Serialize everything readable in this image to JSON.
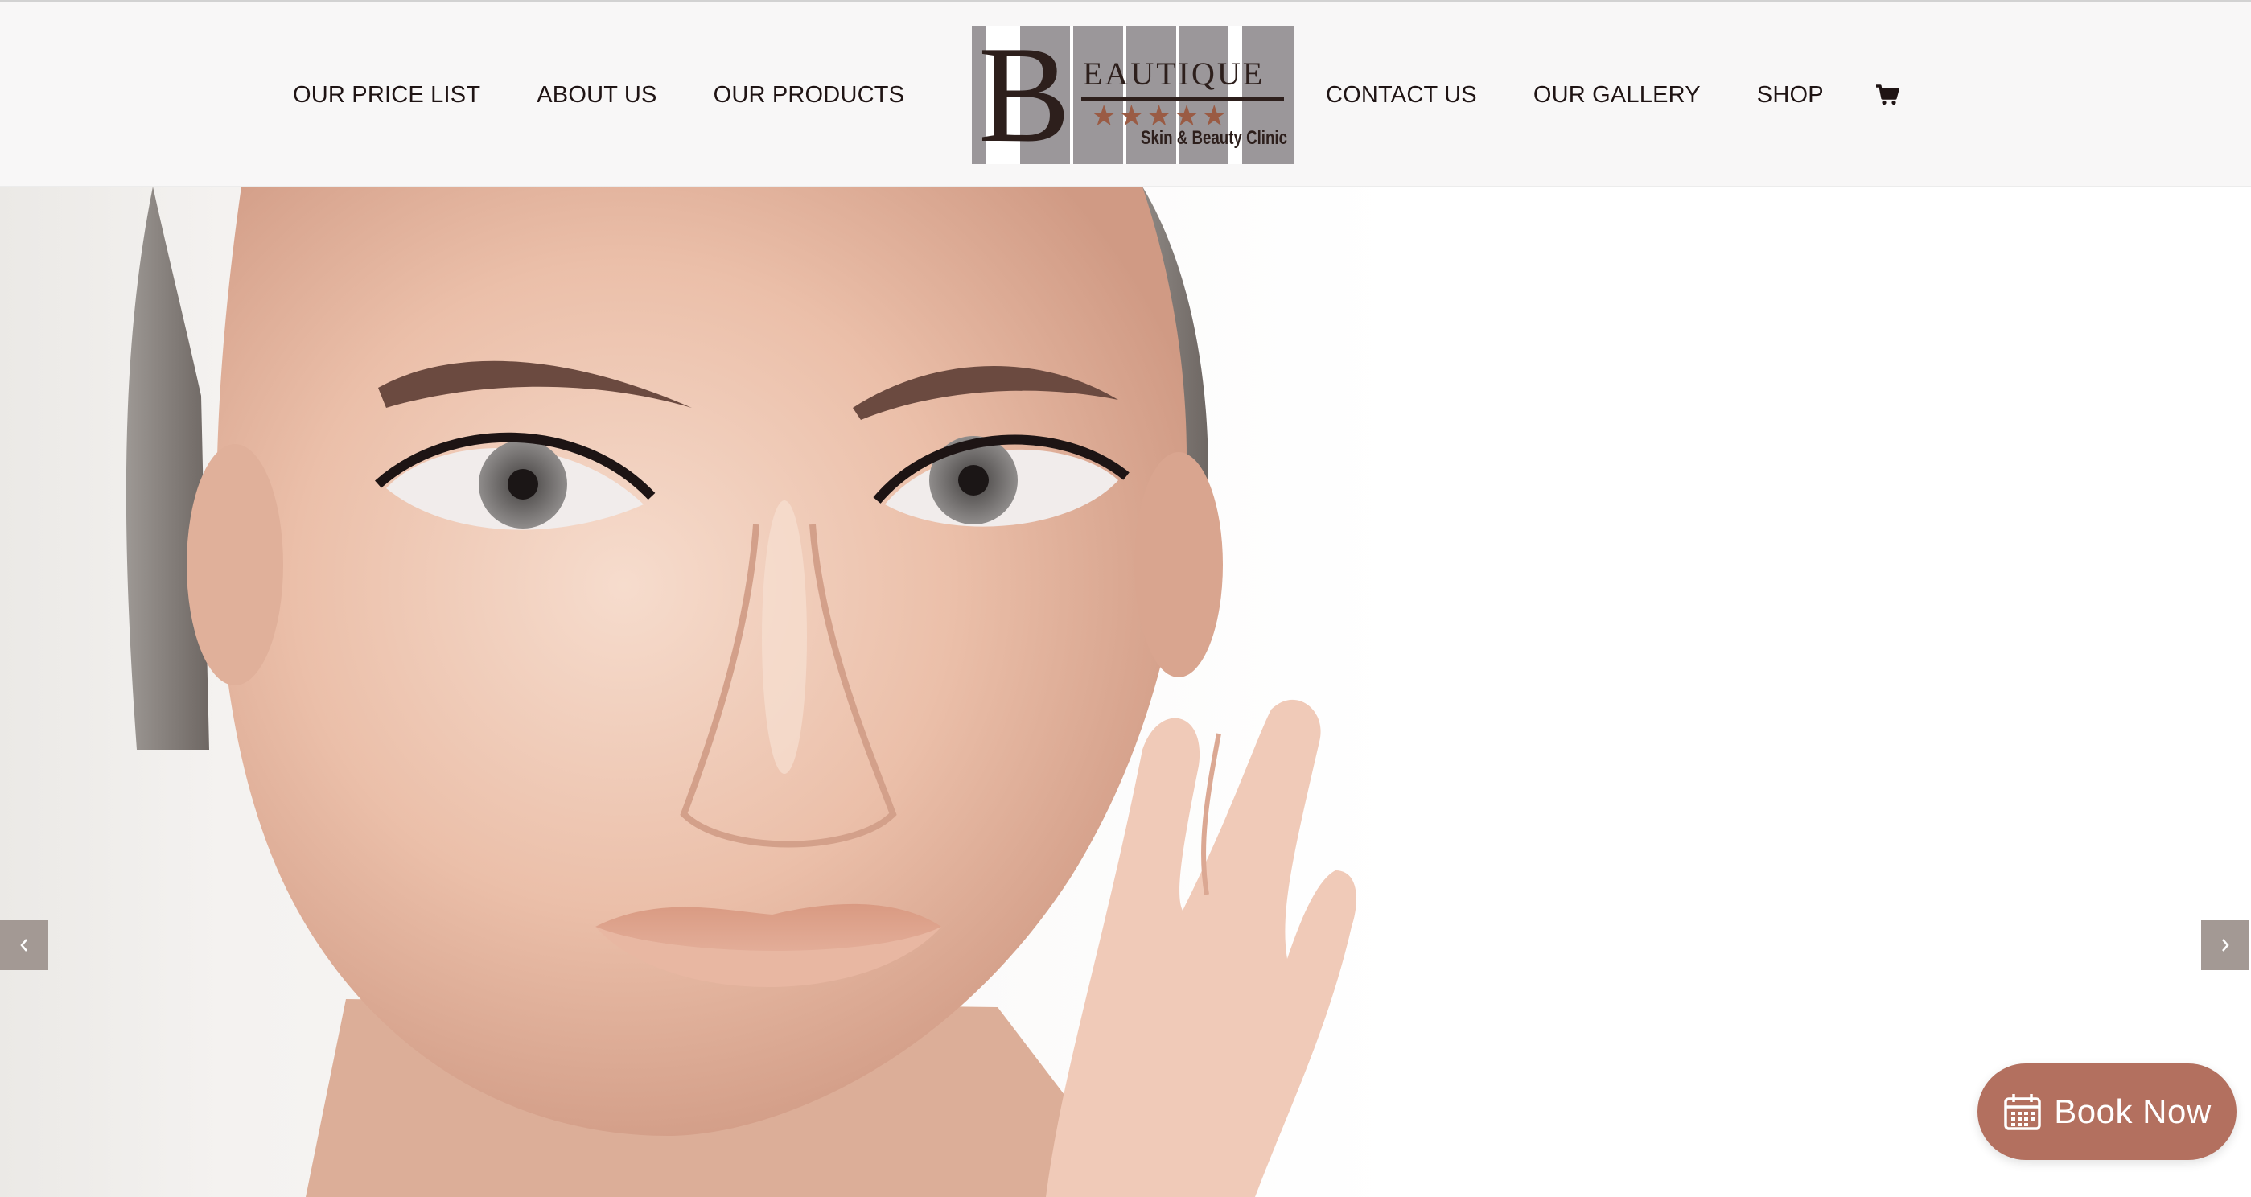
{
  "nav_left": [
    "OUR PRICE LIST",
    "ABOUT US",
    "OUR PRODUCTS"
  ],
  "nav_right": [
    "CONTACT US",
    "OUR GALLERY",
    "SHOP"
  ],
  "logo": {
    "letter": "B",
    "word": "EAUTIQUE",
    "stars": "★★★★★",
    "tagline": "Skin & Beauty Clinic"
  },
  "icons": {
    "cart": "cart-icon",
    "prev": "chevron-left-icon",
    "next": "chevron-right-icon",
    "calendar": "calendar-icon"
  },
  "book_now": {
    "label": "Book Now"
  },
  "colors": {
    "header_bg": "#f8f7f7",
    "nav_text": "#1f1414",
    "logo_dark": "#2d1f1c",
    "logo_stars": "#9a5b44",
    "logo_stripes": "#9b979a",
    "slider_arrow_bg": "#a39994",
    "book_now_bg": "#b3705f"
  }
}
